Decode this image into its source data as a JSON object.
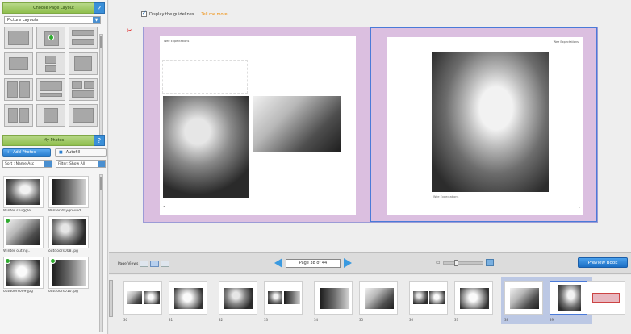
{
  "left_panel": {
    "layouts_header": "Choose Page Layout",
    "layout_select": "Picture Layouts",
    "photos_header": "My Photos",
    "add_photos": "Add Photos",
    "autofill": "Autofill",
    "sort_label": "Sort : Name Asc",
    "filter_label": "Filter: Show All",
    "photos": [
      {
        "caption": "Winter snuggle...",
        "used": false,
        "tone": "bw3"
      },
      {
        "caption": "WinterPlayground...",
        "used": false,
        "tone": "bw5"
      },
      {
        "caption": "Winter outing...",
        "used": true,
        "tone": "bw2"
      },
      {
        "caption": "outdoors008.jpg",
        "used": false,
        "tone": "bw1"
      },
      {
        "caption": "outdoors009.jpg",
        "used": true,
        "tone": "bw4"
      },
      {
        "caption": "outdoors010.jpg",
        "used": true,
        "tone": "bw5"
      }
    ]
  },
  "editor": {
    "guideline_label": "Display the guidelines",
    "tell_me_more": "Tell me more",
    "left_page_title": "Wee Expectations",
    "right_page_title": "Wee Expectations",
    "photo_caption": "Wee Expectations"
  },
  "toolbar": {
    "page_views": "Page Views",
    "page_indicator": "Page 38 of 44",
    "zoom_level": 0.3,
    "preview_button": "Preview Book"
  },
  "thumbnails": {
    "page_numbers": [
      "30",
      "31",
      "32",
      "33",
      "34",
      "35",
      "36",
      "37",
      "38",
      "39"
    ],
    "selected_spread": 4
  },
  "colors": {
    "page_pink": "#dbbfe0",
    "accent_blue": "#2a7fd0",
    "header_green": "#8fbf4e",
    "link_orange": "#f08a00"
  }
}
